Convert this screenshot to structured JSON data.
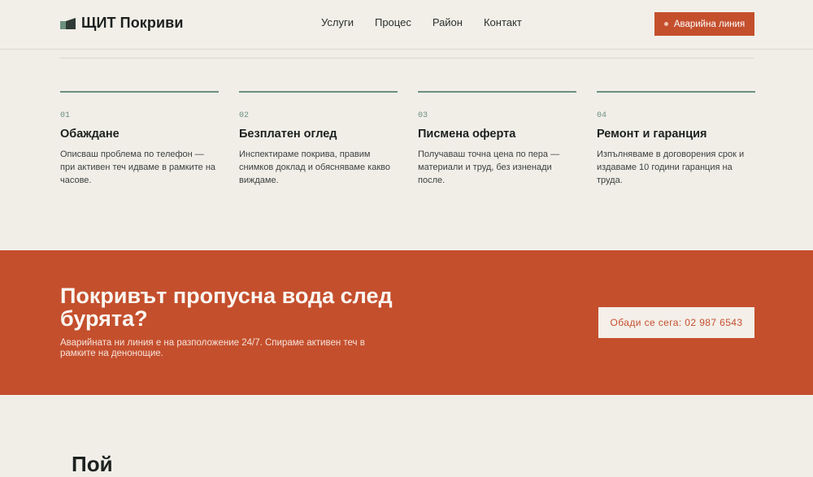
{
  "header": {
    "brand": "ЩИТ Покриви",
    "nav": [
      "Услуги",
      "Процес",
      "Район",
      "Контакт"
    ],
    "emergency_label": "Аварийна линия"
  },
  "steps": [
    {
      "num": "01",
      "title": "Обаждане",
      "text": "Описваш проблема по телефон — при активен теч идваме в рамките на часове."
    },
    {
      "num": "02",
      "title": "Безплатен оглед",
      "text": "Инспектираме покрива, правим снимков доклад и обясняваме какво виждаме."
    },
    {
      "num": "03",
      "title": "Писмена оферта",
      "text": "Получаваш точна цена по пера — материали и труд, без изненади после."
    },
    {
      "num": "04",
      "title": "Ремонт и гаранция",
      "text": "Изпълняваме в договорения срок и издаваме 10 години гаранция на труда."
    }
  ],
  "cta": {
    "title": "Покривът пропусна вода след бурята?",
    "text": "Аварийната ни линия е на разположение 24/7. Спираме активен теч в рамките на денонощие.",
    "button": "Обади се сега: 02 987 6543"
  },
  "next_section": {
    "heading": "Пой"
  },
  "colors": {
    "accent": "#c44f2d",
    "sage": "#6b907d",
    "background": "#f1eee8"
  }
}
